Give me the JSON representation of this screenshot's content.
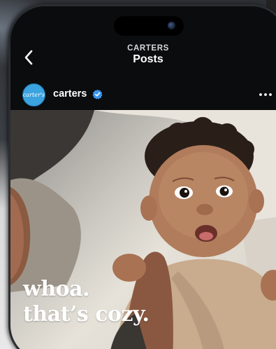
{
  "nav": {
    "account_label": "CARTERS",
    "title": "Posts"
  },
  "post": {
    "avatar_text": "carter's",
    "username": "carters",
    "overlay_line1": "whoa.",
    "overlay_line2": "that’s cozy."
  },
  "colors": {
    "background": "#0b0c0e",
    "avatar": "#3aa3e0",
    "verified": "#3897f0",
    "text": "#ffffff"
  },
  "icons": {
    "back": "chevron-left-icon",
    "verified": "verified-badge-icon",
    "more": "more-horizontal-icon"
  }
}
